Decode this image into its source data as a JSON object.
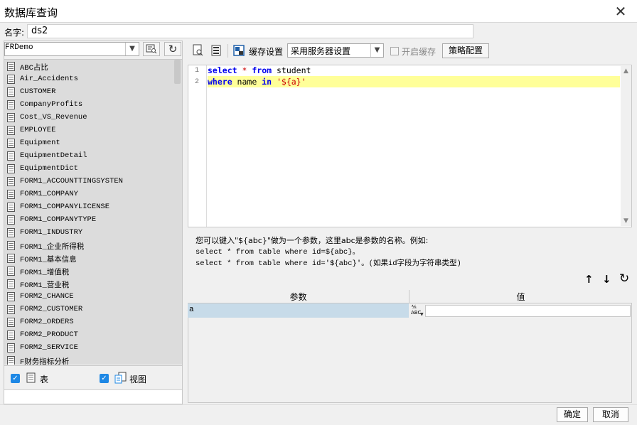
{
  "window": {
    "title": "数据库查询",
    "close_glyph": "✕"
  },
  "name_row": {
    "label": "名字:",
    "value": "ds2"
  },
  "left_panel": {
    "datasource": "FRDemo",
    "tables": [
      "ABC占比",
      "Air_Accidents",
      "CUSTOMER",
      "CompanyProfits",
      "Cost_VS_Revenue",
      "EMPLOYEE",
      "Equipment",
      "EquipmentDetail",
      "EquipmentDict",
      "FORM1_ACCOUNTTINGSYSTEN",
      "FORM1_COMPANY",
      "FORM1_COMPANYLICENSE",
      "FORM1_COMPANYTYPE",
      "FORM1_INDUSTRY",
      "FORM1_企业所得税",
      "FORM1_基本信息",
      "FORM1_增值税",
      "FORM1_营业税",
      "FORM2_CHANCE",
      "FORM2_CUSTOMER",
      "FORM2_ORDERS",
      "FORM2_PRODUCT",
      "FORM2_SERVICE",
      "F财务指标分析"
    ],
    "filters": {
      "table_label": "表",
      "view_label": "视图"
    }
  },
  "toolbar": {
    "cache_settings_label": "缓存设置",
    "cache_mode": "采用服务器设置",
    "enable_cache_label": "开启缓存",
    "policy_button": "策略配置"
  },
  "editor": {
    "line_numbers": [
      "1",
      "2"
    ]
  },
  "hint": {
    "line1": "您可以键入\"${abc}\"做为一个参数，这里abc是参数的名称。例如:",
    "line2": "select * from table where id=${abc}。",
    "line3": "select * from table where id='${abc}'。(如果id字段为字符串类型)"
  },
  "params": {
    "columns": [
      "参数",
      "值"
    ],
    "rows": [
      {
        "name": "a",
        "value": ""
      }
    ],
    "type_badge": "ABC"
  },
  "footer": {
    "ok_label": "确定",
    "cancel_label": "取消"
  },
  "colors": {
    "keyword": "#0000ee",
    "string": "#cc0000",
    "highlight_line": "#ffff99",
    "selected_row": "#c7dbe9",
    "checkbox": "#1e88e5"
  }
}
